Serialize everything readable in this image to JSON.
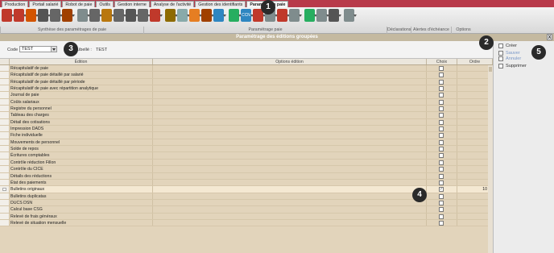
{
  "tabs": [
    "Production",
    "Portail salarié",
    "Robot de paie",
    "Outils",
    "Gestion interne",
    "Analyse de l'activité",
    "Gestion des identifiants",
    "Paramétrage paie"
  ],
  "ribbon": {
    "groups": [
      "Synthèse des paramétrages de paie",
      "Paramétrage paie",
      "Déclarations",
      "Alertes d'échéance",
      "Options"
    ],
    "icons": [
      "report-icon",
      "report-icon",
      "report-icon",
      "clock-icon",
      "clock-icon",
      "report-icon",
      "gear-icon",
      "clock-icon",
      "report-icon",
      "clock-icon",
      "clock-icon",
      "clock-icon",
      "report-icon",
      "coin-icon",
      "user-icon",
      "document-icon",
      "report-icon",
      "help-icon",
      "transfer-icon",
      "ccn-icon",
      "arrows-icon",
      "grid-icon",
      "report-icon",
      "grid-icon",
      "transfer-icon",
      "report-icon",
      "clock-icon",
      "gear-icon"
    ],
    "ccn_label": "CCN"
  },
  "title": "Paramétrage des éditions groupées",
  "codebar": {
    "code_label": "Code :",
    "code_value": "TEST",
    "libelle_label": "Libellé :",
    "libelle_value": "TEST"
  },
  "grid": {
    "headers": [
      "Édition",
      "Options édition",
      "Choix",
      "Ordre"
    ],
    "rows": [
      {
        "edition": "Récapitulatif de paie",
        "options": "",
        "checked": false,
        "order": ""
      },
      {
        "edition": "Récapitulatif de paie détaillé par salarié",
        "options": "",
        "checked": false,
        "order": ""
      },
      {
        "edition": "Récapitulatif de paie détaillé par période",
        "options": "",
        "checked": false,
        "order": ""
      },
      {
        "edition": "Récapitulatif de paie avec répartition analytique",
        "options": "",
        "checked": false,
        "order": ""
      },
      {
        "edition": "Journal de paie",
        "options": "",
        "checked": false,
        "order": ""
      },
      {
        "edition": "Coûts salariaux",
        "options": "",
        "checked": false,
        "order": ""
      },
      {
        "edition": "Registre du personnel",
        "options": "",
        "checked": false,
        "order": ""
      },
      {
        "edition": "Tableau des charges",
        "options": "",
        "checked": false,
        "order": ""
      },
      {
        "edition": "Détail des cotisations",
        "options": "",
        "checked": false,
        "order": ""
      },
      {
        "edition": "Impression DADS",
        "options": "",
        "checked": false,
        "order": ""
      },
      {
        "edition": "Fiche individuelle",
        "options": "",
        "checked": false,
        "order": ""
      },
      {
        "edition": "Mouvements de personnel",
        "options": "",
        "checked": false,
        "order": ""
      },
      {
        "edition": "Solde de repos",
        "options": "",
        "checked": false,
        "order": ""
      },
      {
        "edition": "Écritures comptables",
        "options": "",
        "checked": false,
        "order": ""
      },
      {
        "edition": "Contrôle réduction Fillon",
        "options": "",
        "checked": false,
        "order": ""
      },
      {
        "edition": "Contrôle du CICE",
        "options": "",
        "checked": false,
        "order": ""
      },
      {
        "edition": "Détails des réductions",
        "options": "",
        "checked": false,
        "order": ""
      },
      {
        "edition": "État des paiements",
        "options": "",
        "checked": false,
        "order": ""
      },
      {
        "edition": "Bulletins originaux",
        "options": "",
        "checked": true,
        "order": "10"
      },
      {
        "edition": "Bulletins duplicatas",
        "options": "",
        "checked": false,
        "order": ""
      },
      {
        "edition": "DUCS DSN",
        "options": "",
        "checked": false,
        "order": ""
      },
      {
        "edition": "Calcul base CSG",
        "options": "",
        "checked": false,
        "order": ""
      },
      {
        "edition": "Relevé de frais généraux",
        "options": "",
        "checked": false,
        "order": ""
      },
      {
        "edition": "Relevé de situation mensuelle",
        "options": "",
        "checked": false,
        "order": ""
      }
    ]
  },
  "right_panel": {
    "items": [
      {
        "label": "Créer",
        "icon": "create-icon",
        "enabled": true
      },
      {
        "label": "Sauver",
        "icon": "save-icon",
        "enabled": false
      },
      {
        "label": "Annuler",
        "icon": "cancel-icon",
        "enabled": false
      },
      {
        "label": "Supprimer",
        "icon": "delete-icon",
        "enabled": true
      }
    ]
  },
  "close_label": "X",
  "callouts": [
    "1",
    "2",
    "3",
    "4",
    "5"
  ],
  "colors": {
    "tabbar": "#b83a4a",
    "title": "#c4b9a0",
    "grid": "#e2d4bb",
    "callout": "#2a2a2a"
  }
}
